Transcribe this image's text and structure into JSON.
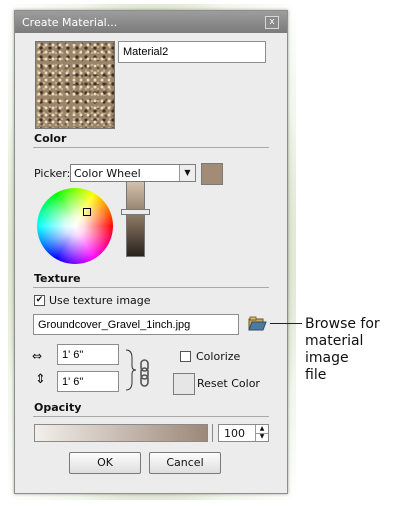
{
  "dialog": {
    "title": "Create Material...",
    "close_glyph": "x",
    "material_name": "Material2"
  },
  "color": {
    "section_label": "Color",
    "picker_label": "Picker:",
    "picker_value": "Color Wheel",
    "swatch_color": "#a28c76"
  },
  "texture": {
    "section_label": "Texture",
    "use_texture_label": "Use texture image",
    "use_texture_checked": true,
    "filename": "Groundcover_Gravel_1inch.jpg",
    "width_value": "1' 6\"",
    "height_value": "1' 6\"",
    "colorize_label": "Colorize",
    "reset_color_label": "Reset Color",
    "browse_icon": "folder-icon"
  },
  "opacity": {
    "section_label": "Opacity",
    "value": "100"
  },
  "buttons": {
    "ok": "OK",
    "cancel": "Cancel"
  },
  "annotation": {
    "line1": "Browse for",
    "line2": "material image",
    "line3": "file"
  }
}
